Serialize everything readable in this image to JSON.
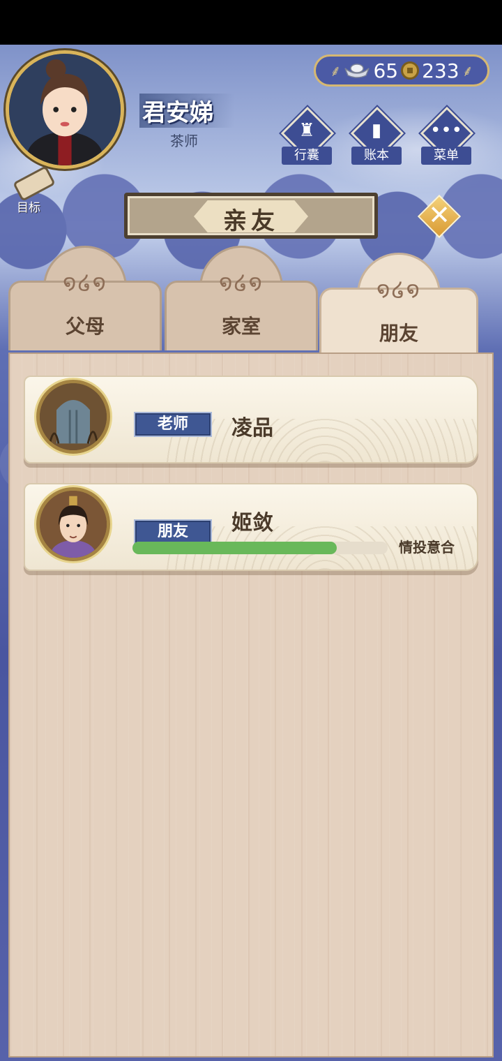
{
  "player": {
    "name": "君安娣",
    "title": "茶师"
  },
  "goal_label": "目标",
  "currency": {
    "silver": "65",
    "copper": "233"
  },
  "menu": [
    {
      "label": "行囊",
      "icon": "bag-icon"
    },
    {
      "label": "账本",
      "icon": "ledger-icon"
    },
    {
      "label": "菜单",
      "icon": "more-icon"
    }
  ],
  "page_title": "亲友",
  "tabs": [
    {
      "label": "父母",
      "active": false
    },
    {
      "label": "家室",
      "active": false
    },
    {
      "label": "朋友",
      "active": true
    }
  ],
  "relations": [
    {
      "relation": "老师",
      "name": "凌品",
      "has_bar": false
    },
    {
      "relation": "朋友",
      "name": "姬敛",
      "has_bar": true,
      "affinity": 0.8,
      "affinity_label": "情投意合"
    }
  ],
  "colors": {
    "accent_gold": "#d9b45a",
    "tag_blue": "#3f5793",
    "affinity_green": "#69b85a"
  }
}
